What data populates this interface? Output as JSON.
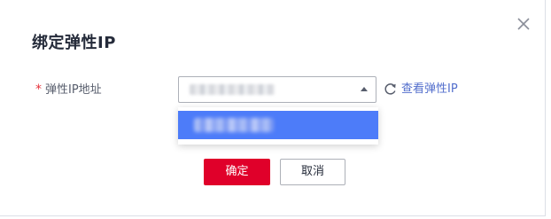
{
  "dialog": {
    "title": "绑定弹性IP",
    "close_icon": "close-icon"
  },
  "form": {
    "field_label": "弹性IP地址",
    "required_mark": "*",
    "select_icon": "caret-up-icon",
    "refresh_icon": "refresh-icon",
    "view_link": "查看弹性IP"
  },
  "buttons": {
    "ok_label": "确定",
    "cancel_label": "取消"
  },
  "colors": {
    "primary": "#e0002a",
    "link": "#526ecc",
    "selected_option": "#4d7cf9",
    "required": "#e6323b"
  }
}
